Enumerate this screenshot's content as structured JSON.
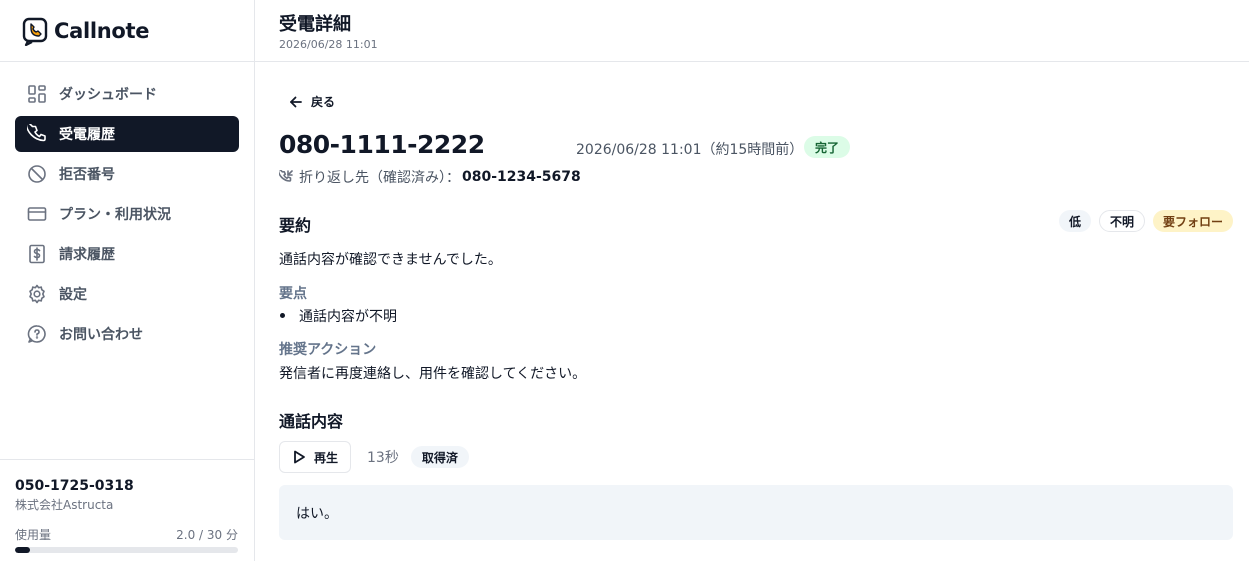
{
  "brand": {
    "name": "Callnote"
  },
  "sidebar": {
    "items": [
      {
        "label": "ダッシュボード",
        "icon": "dashboard-icon",
        "active": false
      },
      {
        "label": "受電履歴",
        "icon": "phone-icon",
        "active": true
      },
      {
        "label": "拒否番号",
        "icon": "block-icon",
        "active": false
      },
      {
        "label": "プラン・利用状況",
        "icon": "credit-card-icon",
        "active": false
      },
      {
        "label": "請求履歴",
        "icon": "receipt-icon",
        "active": false
      },
      {
        "label": "設定",
        "icon": "gear-icon",
        "active": false
      },
      {
        "label": "お問い合わせ",
        "icon": "help-chat-icon",
        "active": false
      }
    ]
  },
  "account": {
    "phone": "050-1725-0318",
    "company": "株式会社Astructa",
    "usage_label": "使用量",
    "usage_text": "2.0 / 30 分",
    "usage_fraction": 0.067
  },
  "header": {
    "title": "受電詳細",
    "subtitle": "2026/06/28 11:01"
  },
  "detail": {
    "back_label": "戻る",
    "caller_number": "080-1111-2222",
    "call_time": "2026/06/28 11:01（約15時間前）",
    "status": "完了",
    "callback_label": "折り返し先（確認済み）：",
    "callback_number": "080-1234-5678"
  },
  "summary": {
    "title": "要約",
    "tags": {
      "priority": "低",
      "category": "不明",
      "follow": "要フォロー"
    },
    "text": "通話内容が確認できませんでした。",
    "points_heading": "要点",
    "points": [
      "通話内容が不明"
    ],
    "action_heading": "推奨アクション",
    "action_text": "発信者に再度連絡し、用件を確認してください。"
  },
  "call_content": {
    "title": "通話内容",
    "play_label": "再生",
    "duration": "13秒",
    "fetch_status": "取得済",
    "transcript": "はい。"
  },
  "colors": {
    "active_nav_bg": "#111827",
    "status_green_bg": "#dcfce7",
    "follow_yellow_bg": "#fef3c7"
  }
}
